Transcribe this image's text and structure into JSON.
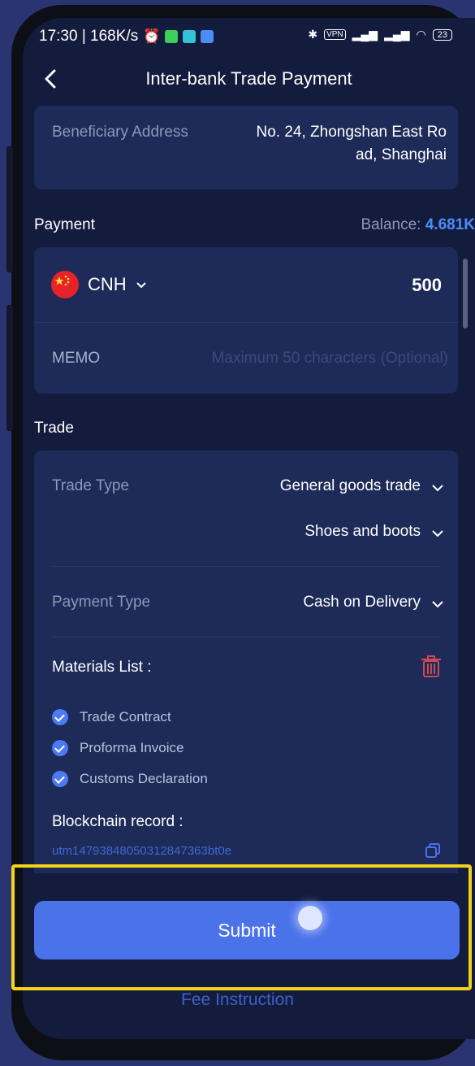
{
  "status_bar": {
    "time_speed": "17:30 | 168K/s",
    "battery": "23"
  },
  "header": {
    "title": "Inter-bank Trade Payment"
  },
  "beneficiary": {
    "label": "Beneficiary Address",
    "value_line1": "No. 24, Zhongshan East Ro",
    "value_line2": "ad, Shanghai"
  },
  "payment": {
    "section_title": "Payment",
    "balance_label": "Balance:",
    "balance_value": "4.681K",
    "currency": "CNH",
    "amount": "500",
    "memo_label": "MEMO",
    "memo_placeholder": "Maximum 50 characters (Optional)"
  },
  "trade": {
    "section_title": "Trade",
    "trade_type_label": "Trade Type",
    "trade_type_value": "General goods trade",
    "trade_subtype_value": "Shoes and boots",
    "payment_type_label": "Payment Type",
    "payment_type_value": "Cash on Delivery",
    "materials_title": "Materials List :",
    "materials": [
      "Trade Contract",
      "Proforma Invoice",
      "Customs Declaration"
    ],
    "blockchain_title": "Blockchain record :",
    "blockchain_value": "utm1479384805031284736​3bt0e"
  },
  "actions": {
    "submit_label": "Submit",
    "fee_label": "Fee Instruction"
  },
  "colors": {
    "accent": "#4a73ea",
    "highlight": "#f3d21a",
    "balance": "#4b8df8",
    "delete": "#c94b5a"
  }
}
